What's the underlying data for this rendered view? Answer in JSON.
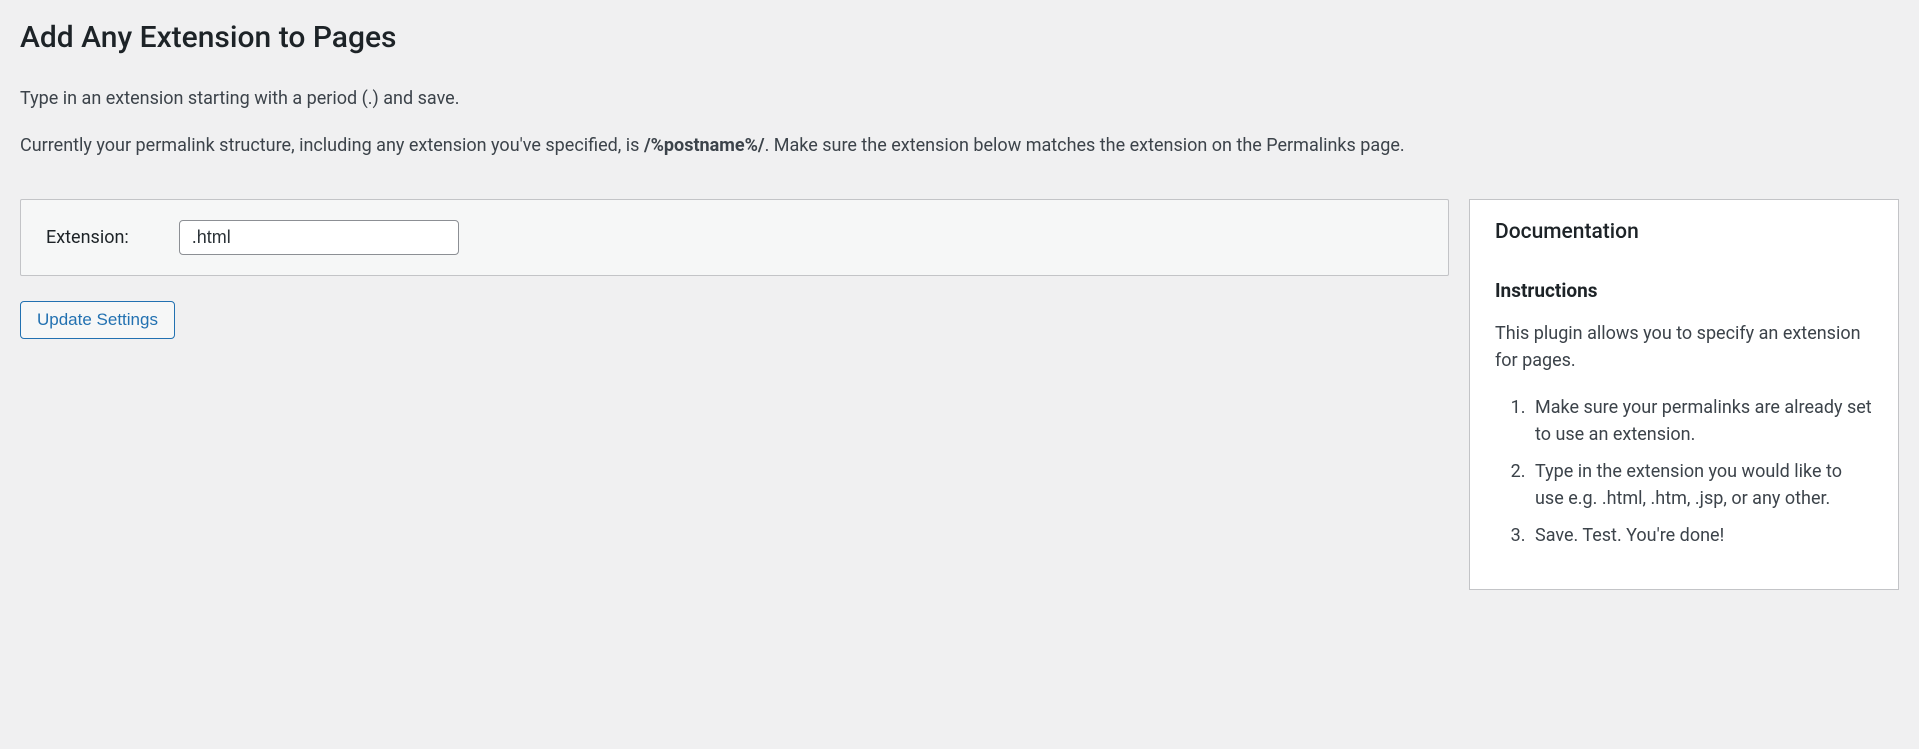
{
  "page": {
    "title": "Add Any Extension to Pages",
    "intro_line1": "Type in an extension starting with a period (.) and save.",
    "intro_line2_prefix": "Currently your permalink structure, including any extension you've specified, is ",
    "permalink_structure": "/%postname%/",
    "intro_line2_suffix": ". Make sure the extension below matches the extension on the Permalinks page."
  },
  "settings": {
    "label": "Extension:",
    "value": ".html",
    "button": "Update Settings"
  },
  "sidebar": {
    "heading": "Documentation",
    "subheading": "Instructions",
    "description": "This plugin allows you to specify an extension for pages.",
    "steps": [
      "Make sure your permalinks are already set to use an extension.",
      "Type in the extension you would like to use e.g. .html, .htm, .jsp, or any other.",
      "Save. Test. You're done!"
    ]
  }
}
